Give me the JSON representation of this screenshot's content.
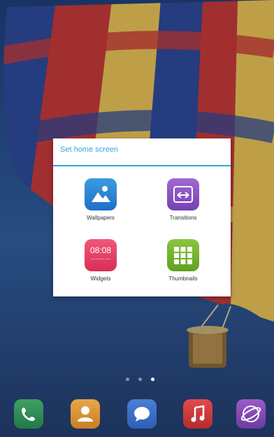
{
  "popup": {
    "title": "Set home screen",
    "options": [
      {
        "label": "Wallpapers",
        "icon": "wallpaper-icon"
      },
      {
        "label": "Transitions",
        "icon": "transitions-icon"
      },
      {
        "label": "Widgets",
        "icon": "widgets-clock-icon",
        "icon_text": "08:08"
      },
      {
        "label": "Thumbnails",
        "icon": "thumbnails-icon"
      }
    ]
  },
  "home_pages": {
    "count": 3,
    "current": 3
  },
  "dock": [
    "phone-icon",
    "contacts-icon",
    "messaging-icon",
    "music-icon",
    "browser-icon"
  ],
  "colors": {
    "accent": "#34a5dd",
    "wallpaper_sky": "#2c4e8e"
  }
}
